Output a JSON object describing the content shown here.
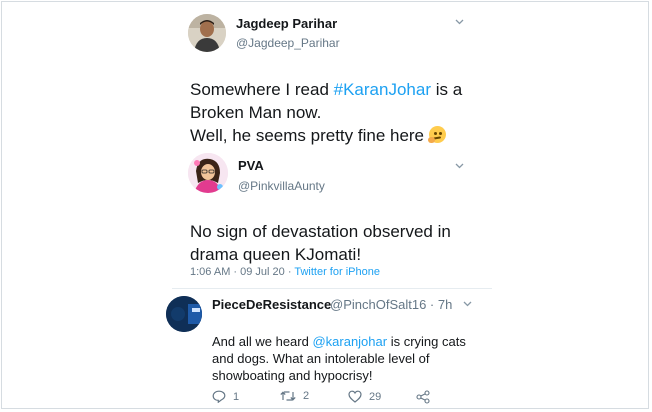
{
  "tweet1": {
    "author_name": "Jagdeep Parihar",
    "handle": "@Jagdeep_Parihar",
    "text_line1_pre": "Somewhere I read ",
    "hashtag": "#KaranJohar",
    "text_line1_post": " is a",
    "text_line2": "Broken Man now.",
    "text_line3": "Well, he seems pretty fine here",
    "emoji": "thinking-face-emoji"
  },
  "tweet2": {
    "author_name": "PVA",
    "handle": "@PinkvillaAunty",
    "text_line1": "No sign of devastation observed in",
    "text_line2": "drama queen KJomati!",
    "timestamp": "1:06 AM · 09 Jul 20 · ",
    "source": "Twitter for iPhone"
  },
  "tweet3": {
    "author_name": "PieceDeResistance",
    "handle_time": "@PinchOfSalt16 · 7h",
    "text_line1_pre": "And all we heard ",
    "mention": "@karanjohar",
    "text_line1_post": " is crying cats",
    "text_line2": "and dogs. What an intolerable level of",
    "text_line3": "showboating and hypocrisy!",
    "actions": {
      "reply_count": "1",
      "retweet_count": "2",
      "like_count": "29"
    }
  },
  "colors": {
    "link": "#1da1f2",
    "muted": "#657786",
    "text": "#14171a",
    "border": "#d6dce1"
  }
}
